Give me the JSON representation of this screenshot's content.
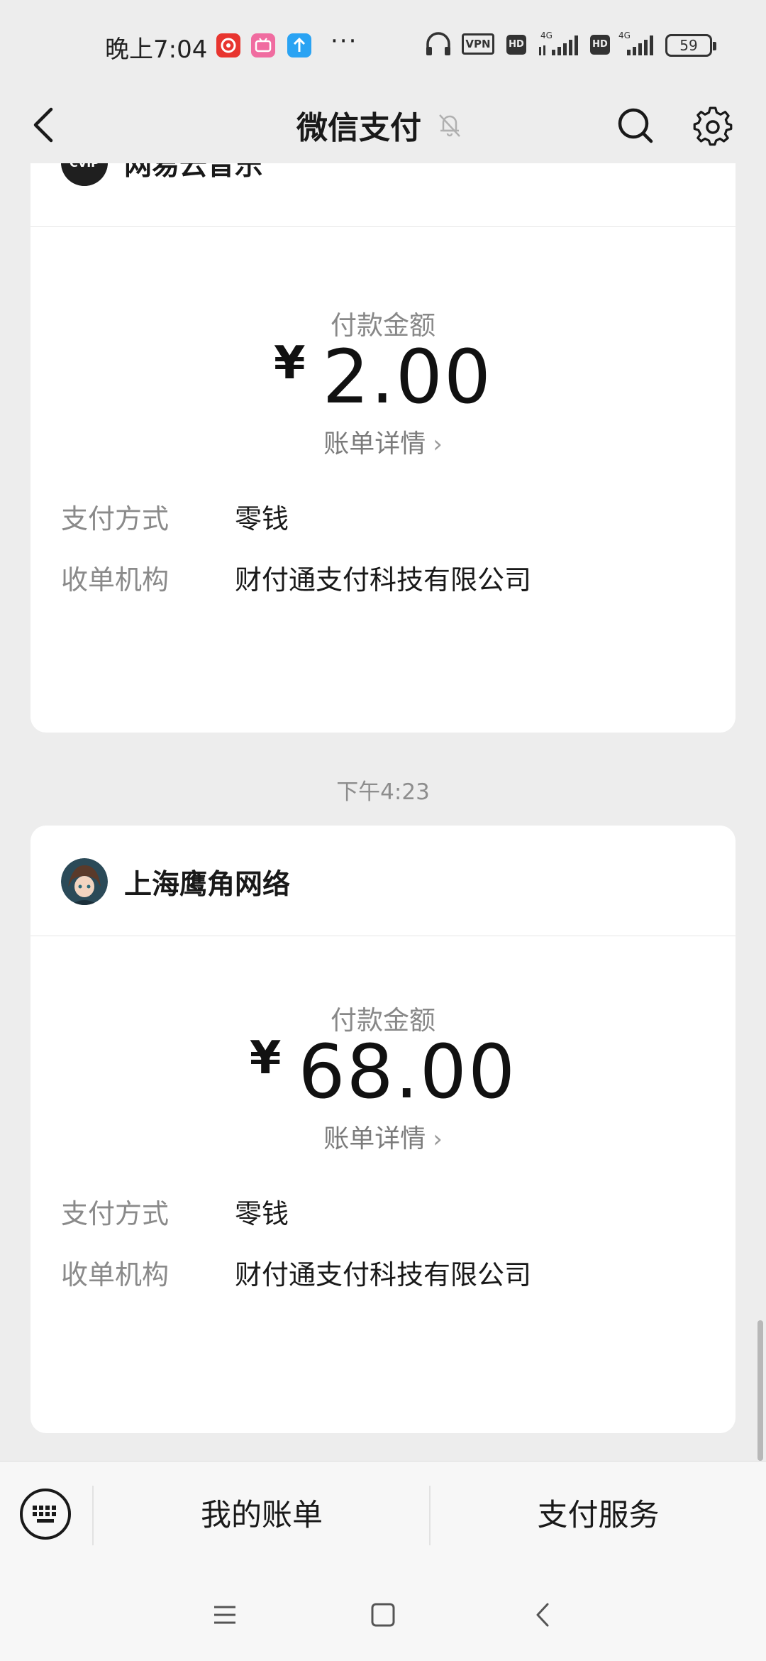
{
  "status_bar": {
    "time": "晚上7:04",
    "more": "···",
    "vpn": "VPN",
    "hd1": "HD",
    "hd2": "HD",
    "net1": "4G",
    "net2": "4G",
    "battery": "59"
  },
  "header": {
    "title": "微信支付",
    "icons": [
      "back-icon",
      "mute-bell-icon",
      "search-icon",
      "gear-icon"
    ]
  },
  "cards": [
    {
      "merchant": "网易云音乐",
      "avatar_text": "CVIP",
      "amount_label": "付款金额",
      "currency": "¥",
      "amount": "2.00",
      "detail_link": "账单详情",
      "rows": [
        {
          "label": "支付方式",
          "value": "零钱"
        },
        {
          "label": "收单机构",
          "value": "财付通支付科技有限公司"
        }
      ]
    },
    {
      "timestamp": "下午4:23",
      "merchant": "上海鹰角网络",
      "amount_label": "付款金额",
      "currency": "¥",
      "amount": "68.00",
      "detail_link": "账单详情",
      "rows": [
        {
          "label": "支付方式",
          "value": "零钱"
        },
        {
          "label": "收单机构",
          "value": "财付通支付科技有限公司"
        }
      ]
    }
  ],
  "bottom_menu": {
    "items": [
      "我的账单",
      "支付服务"
    ],
    "keyboard_icon": "keyboard-icon"
  },
  "nav_bar": {
    "icons": [
      "menu-icon",
      "home-icon",
      "back-icon"
    ]
  },
  "colors": {
    "background": "#ededed",
    "card": "#ffffff",
    "text": "#191919",
    "secondary_text": "#888888"
  }
}
